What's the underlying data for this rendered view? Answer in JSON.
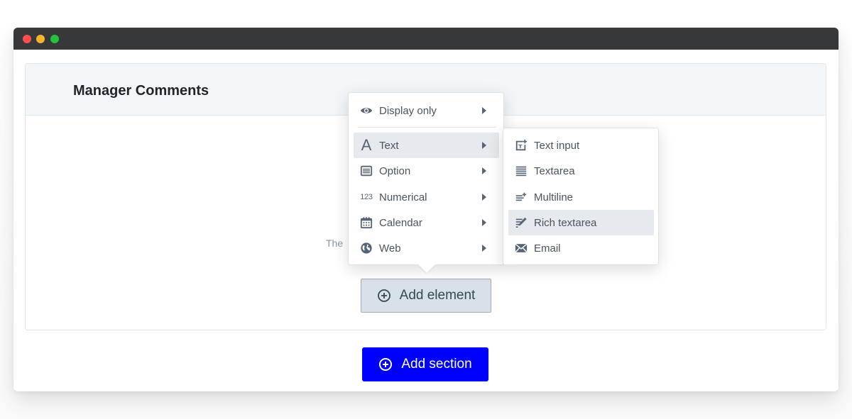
{
  "window": {
    "controls": [
      "close",
      "minimize",
      "maximize"
    ]
  },
  "card": {
    "title": "Manager Comments",
    "empty_text": "The"
  },
  "buttons": {
    "add_element": "Add element",
    "add_section": "Add section"
  },
  "colors": {
    "primary": "#0000ff",
    "titlebar": "#37383a",
    "card_header_bg": "#f3f6f9",
    "menu_active_bg": "#e6e9ed",
    "icon": "#566575"
  },
  "menu": {
    "items": [
      {
        "label": "Display only",
        "icon": "eye-icon",
        "has_submenu": true
      },
      {
        "label": "Text",
        "icon": "text-icon",
        "has_submenu": true,
        "active": true
      },
      {
        "label": "Option",
        "icon": "list-box-icon",
        "has_submenu": true
      },
      {
        "label": "Numerical",
        "icon": "numbers-icon",
        "icon_text": "123",
        "has_submenu": true
      },
      {
        "label": "Calendar",
        "icon": "calendar-icon",
        "has_submenu": true
      },
      {
        "label": "Web",
        "icon": "globe-icon",
        "has_submenu": true
      }
    ]
  },
  "submenu": {
    "items": [
      {
        "label": "Text input",
        "icon": "text-input-icon"
      },
      {
        "label": "Textarea",
        "icon": "textarea-icon"
      },
      {
        "label": "Multiline",
        "icon": "multiline-icon"
      },
      {
        "label": "Rich textarea",
        "icon": "rich-textarea-icon",
        "active": true
      },
      {
        "label": "Email",
        "icon": "email-icon"
      }
    ]
  }
}
